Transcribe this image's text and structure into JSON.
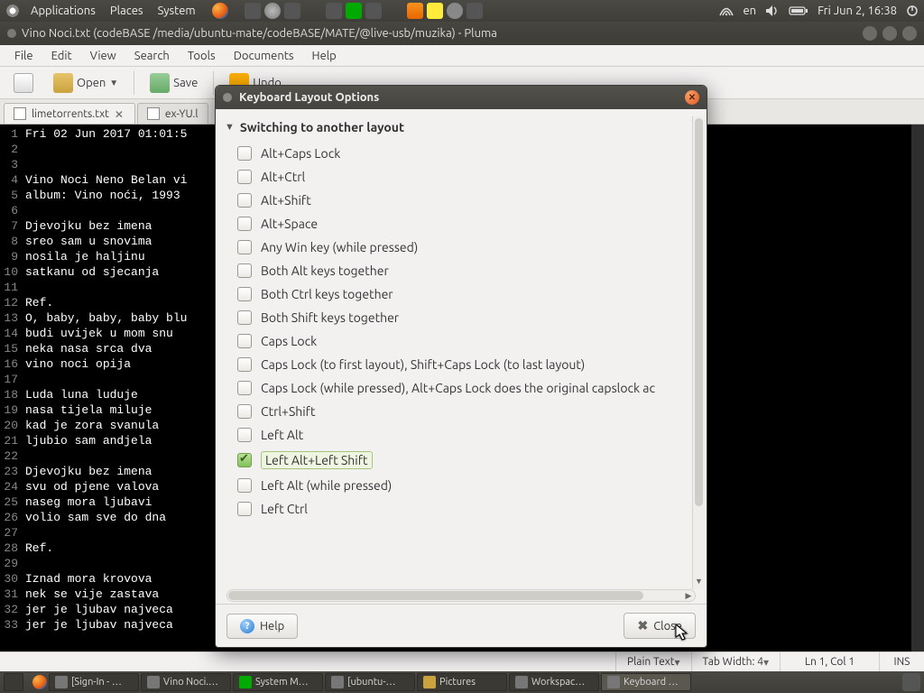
{
  "top_panel": {
    "menus": [
      "Applications",
      "Places",
      "System"
    ],
    "lang": "en",
    "clock": "Fri Jun  2, 16:38"
  },
  "pluma": {
    "title": "Vino Noci.txt (codeBASE /media/ubuntu-mate/codeBASE/MATE/@live-usb/muzika) - Pluma",
    "menubar": [
      "File",
      "Edit",
      "View",
      "Search",
      "Tools",
      "Documents",
      "Help"
    ],
    "toolbar": {
      "open": "Open",
      "save": "Save",
      "undo": "Undo"
    },
    "tabs": [
      {
        "label": "limetorrents.txt",
        "active": true
      },
      {
        "label": "ex-YU.l",
        "active": false
      }
    ],
    "lines": [
      "Fri 02 Jun 2017 01:01:5",
      "",
      "",
      "Vino Noci Neno Belan vi",
      "album: Vino noći, 1993",
      "",
      "Djevojku bez imena",
      "sreo sam u snovima",
      "nosila je haljinu",
      "satkanu od sjecanja",
      "",
      "Ref.",
      "O, baby, baby, baby blu",
      "budi uvijek u mom snu",
      "neka nasa srca dva",
      "vino noci opija",
      "",
      "Luda luna luduje",
      "nasa tijela miluje",
      "kad je zora svanula",
      "ljubio sam andjela",
      "",
      "Djevojku bez imena",
      "svu od pjene valova",
      "naseg mora ljubavi",
      "volio sam sve do dna",
      "",
      "Ref.",
      "",
      "Iznad mora krovova",
      "nek se vije zastava",
      "jer je ljubav najveca",
      "jer je ljubav najveca"
    ],
    "status": {
      "syntax": "Plain Text",
      "tabwidth": "Tab Width: 4",
      "position": "Ln 1, Col 1",
      "mode": "INS"
    }
  },
  "dialog": {
    "title": "Keyboard Layout Options",
    "section": "Switching to another layout",
    "options": [
      {
        "label": "Alt+Caps Lock",
        "checked": false
      },
      {
        "label": "Alt+Ctrl",
        "checked": false
      },
      {
        "label": "Alt+Shift",
        "checked": false
      },
      {
        "label": "Alt+Space",
        "checked": false
      },
      {
        "label": "Any Win key (while pressed)",
        "checked": false
      },
      {
        "label": "Both Alt keys together",
        "checked": false
      },
      {
        "label": "Both Ctrl keys together",
        "checked": false
      },
      {
        "label": "Both Shift keys together",
        "checked": false
      },
      {
        "label": "Caps Lock",
        "checked": false
      },
      {
        "label": "Caps Lock (to first layout), Shift+Caps Lock (to last layout)",
        "checked": false
      },
      {
        "label": "Caps Lock (while pressed), Alt+Caps Lock does the original capslock ac",
        "checked": false
      },
      {
        "label": "Ctrl+Shift",
        "checked": false
      },
      {
        "label": "Left Alt",
        "checked": false
      },
      {
        "label": "Left Alt+Left Shift",
        "checked": true
      },
      {
        "label": "Left Alt (while pressed)",
        "checked": false
      },
      {
        "label": "Left Ctrl",
        "checked": false
      }
    ],
    "help": "Help",
    "close": "Close"
  },
  "taskbar": [
    "[Sign-In - …",
    "Vino Noci.…",
    "System M…",
    "[ubuntu-…",
    "Pictures",
    "Workspac…",
    "Keyboard …"
  ]
}
